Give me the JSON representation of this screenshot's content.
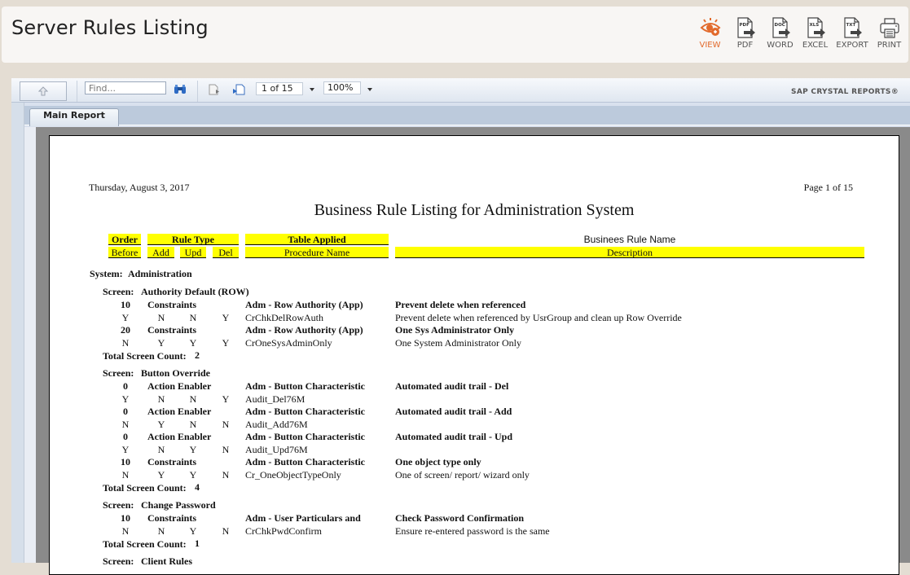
{
  "app": {
    "title": "Server Rules Listing"
  },
  "export_bar": {
    "buttons": [
      {
        "label": "VIEW",
        "icon": "eye-icon",
        "active": true,
        "accent": "#e26a2c"
      },
      {
        "label": "PDF",
        "icon": "pdf-file-icon",
        "badge": "PDF"
      },
      {
        "label": "WORD",
        "icon": "doc-file-icon",
        "badge": "DOC"
      },
      {
        "label": "EXCEL",
        "icon": "xls-file-icon",
        "badge": "XLS"
      },
      {
        "label": "EXPORT",
        "icon": "txt-file-icon",
        "badge": "TXT"
      },
      {
        "label": "PRINT",
        "icon": "printer-icon"
      }
    ]
  },
  "viewer": {
    "find_placeholder": "Find...",
    "page_selector": "1 of 15",
    "zoom_level": "100%",
    "brand": "SAP CRYSTAL REPORTS®",
    "tabs": [
      {
        "label": "Main Report"
      }
    ]
  },
  "report": {
    "date": "Thursday, August 3, 2017",
    "page_number": "Page 1 of 15",
    "title": "Business Rule Listing for Administration System",
    "columns": {
      "order": "Order",
      "before": "Before",
      "rule_type": "Rule Type",
      "add": "Add",
      "upd": "Upd",
      "del": "Del",
      "table_applied": "Table Applied",
      "procedure_name": "Procedure Name",
      "rule_name": "Businees Rule Name",
      "description": "Description"
    },
    "system_label": "System:",
    "system_name": "Administration",
    "screen_label": "Screen:",
    "total_label": "Total Screen Count:",
    "screens": [
      {
        "name": "Authority Default (ROW)",
        "rules": [
          {
            "order": "10",
            "type": "Constraints",
            "table": "Adm - Row Authority (App)",
            "rule_name": "Prevent delete when referenced",
            "before": "Y",
            "add": "N",
            "upd": "N",
            "del": "Y",
            "procedure": "CrChkDelRowAuth",
            "description": "Prevent delete when referenced by UsrGroup and clean up Row Override"
          },
          {
            "order": "20",
            "type": "Constraints",
            "table": "Adm - Row Authority (App)",
            "rule_name": "One Sys Administrator Only",
            "before": "N",
            "add": "Y",
            "upd": "Y",
            "del": "Y",
            "procedure": "CrOneSysAdminOnly",
            "description": "One System Administrator Only"
          }
        ],
        "total": "2"
      },
      {
        "name": "Button Override",
        "rules": [
          {
            "order": "0",
            "type": "Action Enabler",
            "table": "Adm - Button Characteristic",
            "rule_name": "Automated audit trail - Del",
            "before": "Y",
            "add": "N",
            "upd": "N",
            "del": "Y",
            "procedure": "Audit_Del76M",
            "description": ""
          },
          {
            "order": "0",
            "type": "Action Enabler",
            "table": "Adm - Button Characteristic",
            "rule_name": "Automated audit trail - Add",
            "before": "N",
            "add": "Y",
            "upd": "N",
            "del": "N",
            "procedure": "Audit_Add76M",
            "description": ""
          },
          {
            "order": "0",
            "type": "Action Enabler",
            "table": "Adm - Button Characteristic",
            "rule_name": "Automated audit trail - Upd",
            "before": "Y",
            "add": "N",
            "upd": "Y",
            "del": "N",
            "procedure": "Audit_Upd76M",
            "description": ""
          },
          {
            "order": "10",
            "type": "Constraints",
            "table": "Adm - Button Characteristic",
            "rule_name": "One object type only",
            "before": "N",
            "add": "Y",
            "upd": "Y",
            "del": "N",
            "procedure": "Cr_OneObjectTypeOnly",
            "description": "One of screen/ report/ wizard only"
          }
        ],
        "total": "4"
      },
      {
        "name": "Change Password",
        "rules": [
          {
            "order": "10",
            "type": "Constraints",
            "table": "Adm - User Particulars and",
            "rule_name": "Check Password Confirmation",
            "before": "N",
            "add": "N",
            "upd": "Y",
            "del": "N",
            "procedure": "CrChkPwdConfirm",
            "description": "Ensure re-entered password is the same"
          }
        ],
        "total": "1"
      },
      {
        "name": "Client Rules",
        "rules": [],
        "total": ""
      }
    ]
  }
}
